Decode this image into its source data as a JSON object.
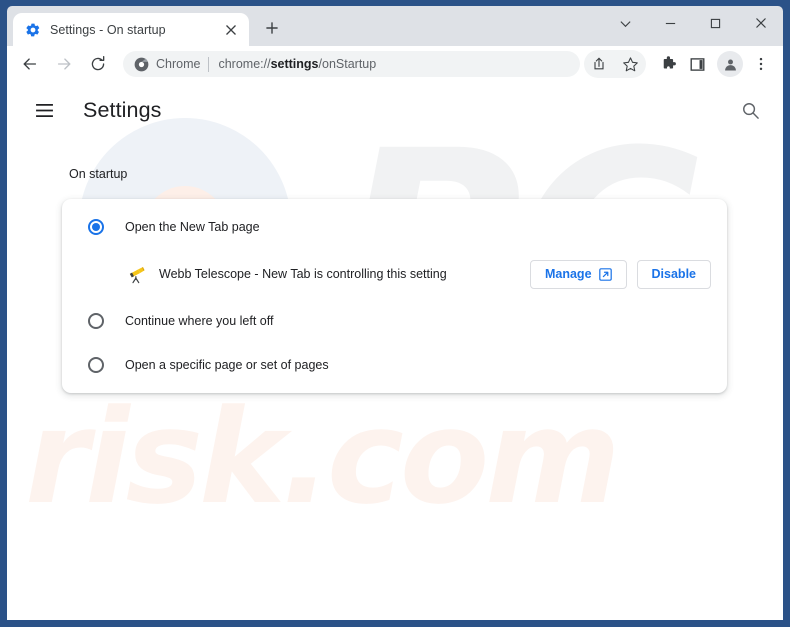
{
  "window": {
    "frame_color": "#2b5288",
    "controls": [
      {
        "name": "tab-search-chevron",
        "glyph": "chevron-down-icon"
      },
      {
        "name": "minimize",
        "glyph": "minimize-icon"
      },
      {
        "name": "maximize",
        "glyph": "maximize-icon"
      },
      {
        "name": "close",
        "glyph": "close-icon"
      }
    ]
  },
  "tabs": {
    "active": {
      "title": "Settings - On startup",
      "favicon": "gear-icon",
      "close_label": "×"
    },
    "new_tab_label": "+"
  },
  "toolbar": {
    "back_label": "Back",
    "forward_label": "Forward",
    "reload_label": "Reload",
    "omnibox": {
      "brand_label": "Chrome",
      "brand_icon": "chrome-logo-icon",
      "url_prefix": "chrome://",
      "url_strong": "settings",
      "url_suffix": "/onStartup",
      "url_full": "chrome://settings/onStartup"
    },
    "share_label": "Share",
    "bookmark_label": "Bookmark this tab",
    "extensions_label": "Extensions",
    "side_panel_label": "Side panel",
    "profile_label": "Profile",
    "menu_label": "Customize and control Google Chrome"
  },
  "settings": {
    "menu_button_label": "Main menu",
    "title": "Settings",
    "search_label": "Search settings",
    "section_label": "On startup",
    "accent_color": "#1a73e8",
    "options": [
      {
        "label": "Open the New Tab page",
        "checked": true
      },
      {
        "label": "Continue where you left off",
        "checked": false
      },
      {
        "label": "Open a specific page or set of pages",
        "checked": false
      }
    ],
    "extension_notice": {
      "icon": "telescope-icon",
      "text": "Webb Telescope - New Tab is controlling this setting",
      "manage_label": "Manage",
      "manage_icon": "open-in-new-icon",
      "disable_label": "Disable"
    }
  },
  "watermarks": {
    "primary": "PC",
    "secondary": "risk.com",
    "primary_color": "#f1f2f3",
    "secondary_color": "#fdf3ee"
  }
}
